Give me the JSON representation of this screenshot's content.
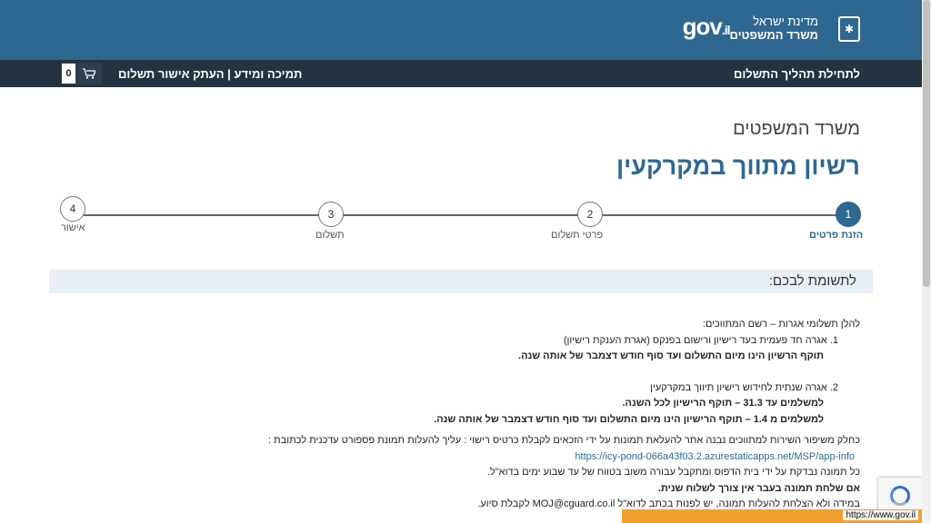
{
  "header": {
    "brand_line1": "מדינת ישראל",
    "brand_line2": "משרד המשפטים",
    "logo_text": "gov",
    "logo_suffix": ".il"
  },
  "nav": {
    "start_process": "לתחילת תהליך התשלום",
    "support": "תמיכה ומידע",
    "separator": "|",
    "copy_confirmation": "העתק אישור תשלום",
    "cart_count": "0"
  },
  "page": {
    "ministry": "משרד המשפטים",
    "title": "רשיון מתווך במקרקעין"
  },
  "steps": [
    {
      "number": "1",
      "label": "הזנת פרטים",
      "active": true
    },
    {
      "number": "2",
      "label": "פרטי תשלום",
      "active": false
    },
    {
      "number": "3",
      "label": "תשלום",
      "active": false
    },
    {
      "number": "4",
      "label": "אישור",
      "active": false
    }
  ],
  "notice": {
    "title": "לתשומת לבכם:",
    "intro": "להלן תשלומי אגרות – רשם המתווכים:",
    "item1": "1. אגרה חד פעמית בעד רישיון ורישום בפנקס (אגרת הענקת רישיון)",
    "item1_bold": "תוקף הרשיון הינו מיום התשלום ועד סוף חודש דצמבר של אותה שנה.",
    "item2": "2. אגרה שנתית לחידוש רישיון תיווך במקרקעין",
    "item2_bold1": "למשלמים עד 31.3 – תוקף הרישיון לכל השנה.",
    "item2_bold2": "למשלמים מ 1.4 – תוקף הרישיון הינו מיום התשלום ועד סוף חודש דצמבר של אותה שנה.",
    "photo_text": "כחלק משיפור השירות למתווכים נבנה אתר להעלאת תמונות על ידי הזכאים לקבלת כרטיס רישוי : עליך להעלות תמונת פספורט עדכנית לכתובת :",
    "photo_url": "https://icy-pond-066a43f03.2.azurestaticapps.net/MSP/app-info",
    "check_text": "כל תמונה נבדקת על ידי בית הדפוס ומתקבל עבורה משוב בטווח של עד שבוע ימים בדוא\"ל.",
    "bold_text": "אם שלחת תמונה בעבר אין צורך לשלוח שנית.",
    "help_text_pre": "במידה ולא הצלחת להעלות תמונה, יש לפנות בכתב לדוא\"ל ",
    "help_email": "MOJ@cguard.co.il",
    "help_text_post": " לקבלת סיוע."
  },
  "status_bar": {
    "url": "https://www.gov.il"
  },
  "icons": {
    "cart": "cart-icon",
    "emblem": "menorah-emblem-icon",
    "recaptcha": "recaptcha-icon"
  },
  "colors": {
    "header": "#2e6890",
    "navbar": "#253340",
    "accent": "#2e6890",
    "notice_bg": "#e8eff6"
  }
}
